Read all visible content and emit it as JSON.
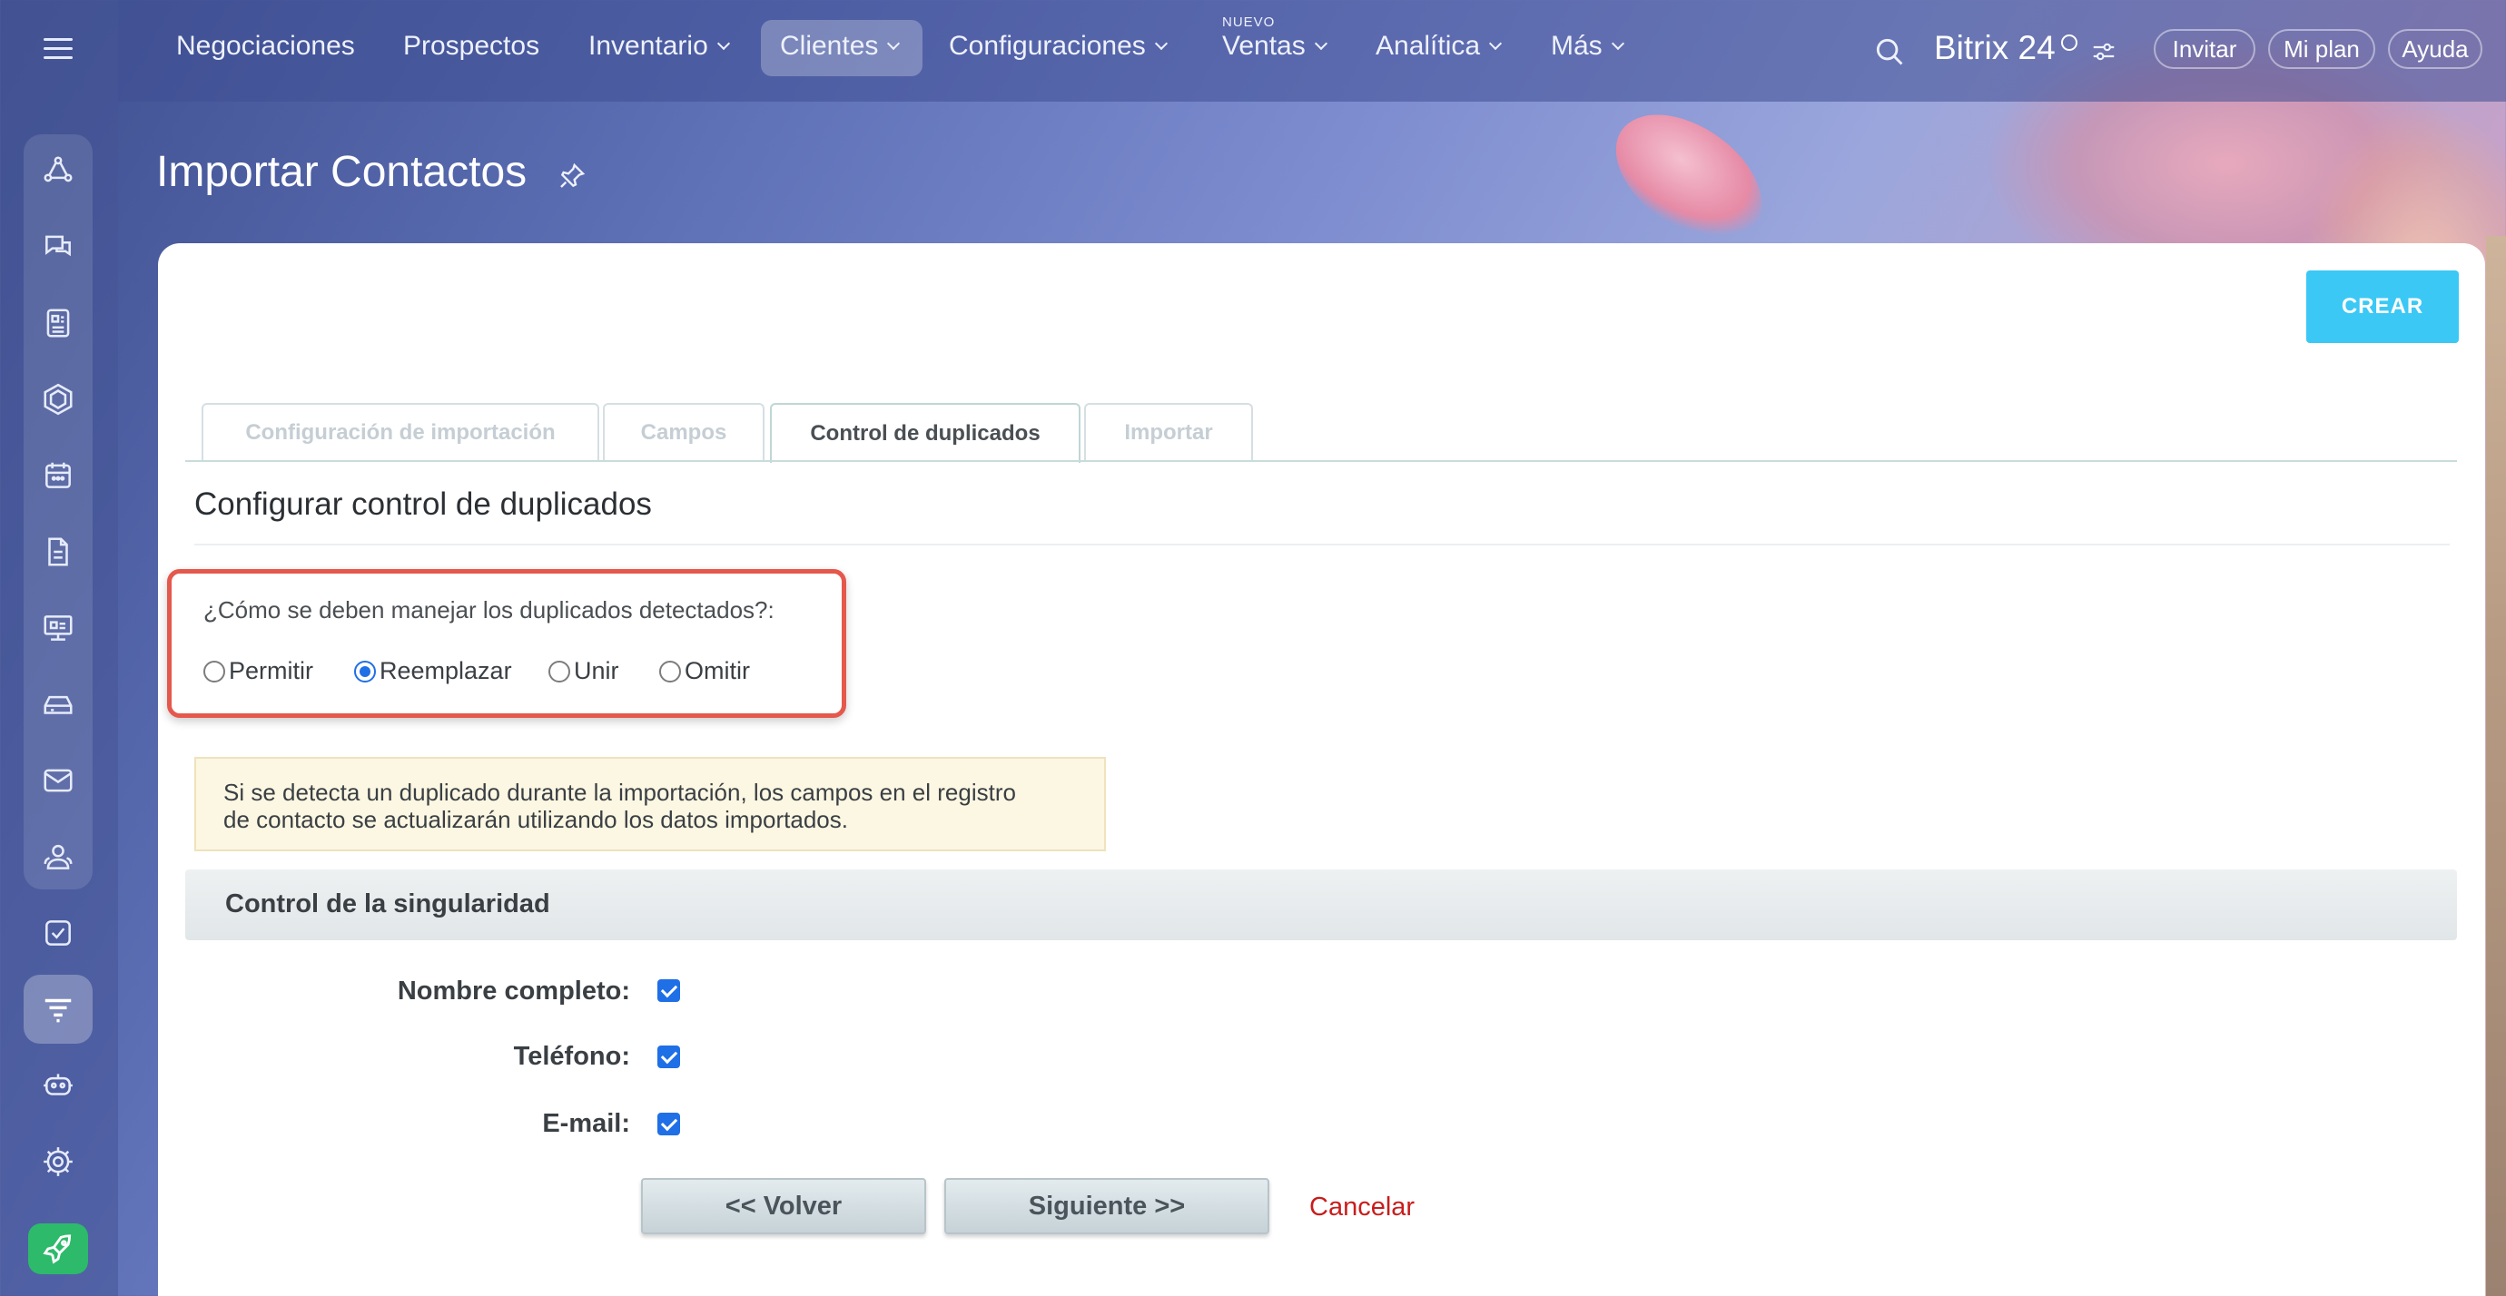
{
  "topbar": {
    "nav": [
      {
        "label": "Negociaciones"
      },
      {
        "label": "Prospectos"
      },
      {
        "label": "Inventario"
      },
      {
        "label": "Clientes"
      },
      {
        "label": "Configuraciones"
      },
      {
        "label": "Ventas",
        "badge": "NUEVO"
      },
      {
        "label": "Analítica"
      },
      {
        "label": "Más"
      }
    ],
    "brand": "Bitrix 24",
    "invite": "Invitar",
    "plan": "Mi plan",
    "help": "Ayuda"
  },
  "sidebar": {
    "items": [
      {
        "icon": "workflow-icon"
      },
      {
        "icon": "chat-icon"
      },
      {
        "icon": "feed-icon"
      },
      {
        "icon": "hexagon-icon"
      },
      {
        "icon": "calendar-icon"
      },
      {
        "icon": "document-icon"
      },
      {
        "icon": "presentation-icon"
      },
      {
        "icon": "drive-icon"
      },
      {
        "icon": "mail-icon"
      },
      {
        "icon": "contacts-icon"
      },
      {
        "icon": "tasks-icon"
      },
      {
        "icon": "crm-funnel-icon",
        "active": true
      },
      {
        "icon": "robot-icon"
      },
      {
        "icon": "settings-icon"
      },
      {
        "icon": "rocket-icon"
      }
    ]
  },
  "page": {
    "title": "Importar Contactos",
    "create_button": "CREAR"
  },
  "tabs": [
    {
      "label": "Configuración de importación",
      "active": false
    },
    {
      "label": "Campos",
      "active": false
    },
    {
      "label": "Control de duplicados",
      "active": true
    },
    {
      "label": "Importar",
      "active": false
    }
  ],
  "duplicates": {
    "section_title": "Configurar control de duplicados",
    "question": "¿Cómo se deben manejar los duplicados detectados?:",
    "options": [
      {
        "label": "Permitir",
        "checked": false
      },
      {
        "label": "Reemplazar",
        "checked": true
      },
      {
        "label": "Unir",
        "checked": false
      },
      {
        "label": "Omitir",
        "checked": false
      }
    ],
    "info_line1": "Si se detecta un duplicado durante la importación, los campos en el registro",
    "info_line2": "de contacto se actualizarán utilizando los datos importados."
  },
  "uniqueness": {
    "title": "Control de la singularidad",
    "fields": [
      {
        "label": "Nombre completo:",
        "checked": true
      },
      {
        "label": "Teléfono:",
        "checked": true
      },
      {
        "label": "E-mail:",
        "checked": true
      }
    ]
  },
  "actions": {
    "back": "<< Volver",
    "next": "Siguiente >>",
    "cancel": "Cancelar"
  },
  "colors": {
    "accent": "#3bc8f5",
    "highlight_border": "#e5584c",
    "checkbox": "#1f6fe6",
    "cancel": "#c81d1d"
  }
}
